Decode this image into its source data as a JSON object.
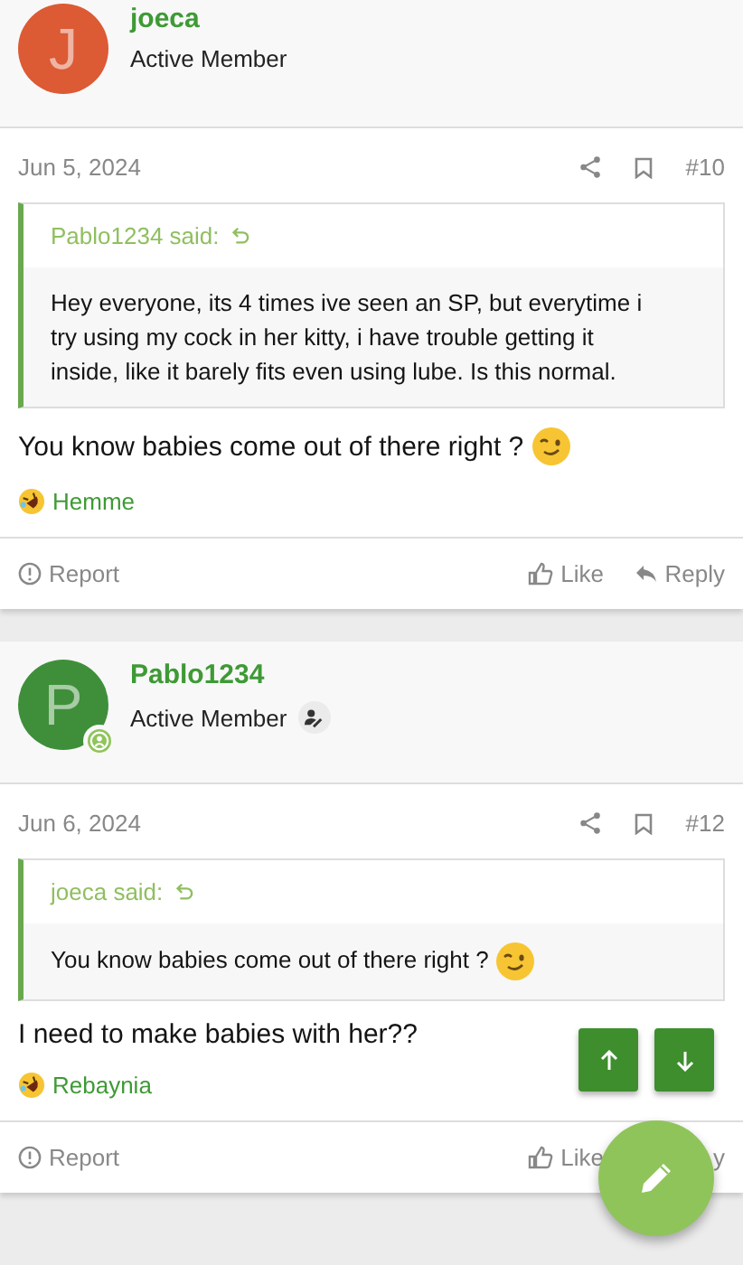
{
  "posts": [
    {
      "author": {
        "initial": "J",
        "color": "#dc5a34",
        "name": "joeca",
        "title": "Active Member",
        "online": false,
        "verified": false
      },
      "date": "Jun 5, 2024",
      "number": "#10",
      "quote": {
        "author": "Pablo1234 said:",
        "text": "Hey everyone, its 4 times ive seen an SP, but everytime i try using my cock in her kitty, i have trouble getting it inside, like it barely fits even using lube. Is this normal.",
        "wink": false
      },
      "message": "You know babies come out of there right ?",
      "wink": true,
      "reaction": "Hemme",
      "actions": {
        "report": "Report",
        "like": "Like",
        "reply": "Reply",
        "reply_icon": true
      }
    },
    {
      "author": {
        "initial": "P",
        "color": "#3f8f3a",
        "name": "Pablo1234",
        "title": "Active Member",
        "online": true,
        "verified": true
      },
      "date": "Jun 6, 2024",
      "number": "#12",
      "quote": {
        "author": "joeca said:",
        "text": "You know babies come out of there right ?",
        "wink": true
      },
      "message": "I need to make babies with her??",
      "wink": false,
      "reaction": "Rebaynia",
      "actions": {
        "report": "Report",
        "like": "Like",
        "reply": "y",
        "reply_icon": false
      }
    }
  ]
}
